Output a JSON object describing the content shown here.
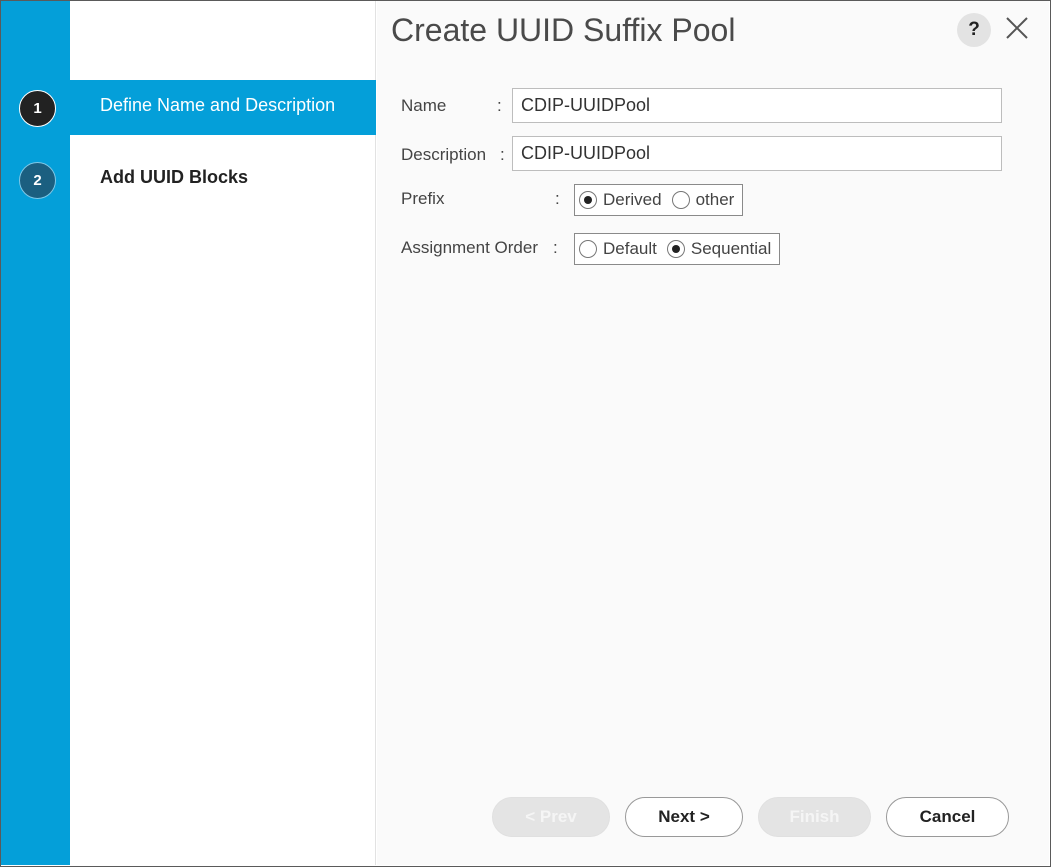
{
  "dialog": {
    "title": "Create UUID Suffix Pool",
    "help_icon": "question-mark-icon",
    "help_glyph": "?",
    "close_icon": "close-x-icon"
  },
  "wizard": {
    "steps": [
      {
        "number": "1",
        "label": "Define Name and Description",
        "active": true
      },
      {
        "number": "2",
        "label": "Add UUID Blocks",
        "active": false
      }
    ]
  },
  "form": {
    "name": {
      "label": "Name",
      "colon": ":",
      "value": "CDIP-UUIDPool"
    },
    "description": {
      "label": "Description",
      "colon": ":",
      "value": "CDIP-UUIDPool"
    },
    "prefix": {
      "label": "Prefix",
      "colon": ":",
      "options": [
        {
          "label": "Derived",
          "checked": true
        },
        {
          "label": "other",
          "checked": false
        }
      ]
    },
    "assignment_order": {
      "label": "Assignment Order",
      "colon": ":",
      "options": [
        {
          "label": "Default",
          "checked": false
        },
        {
          "label": "Sequential",
          "checked": true
        }
      ]
    }
  },
  "buttons": {
    "prev": "< Prev",
    "next": "Next >",
    "finish": "Finish",
    "cancel": "Cancel"
  },
  "colors": {
    "accent_blue": "#049fd9",
    "step_active_circle": "#222222",
    "step_inactive_circle": "#1b5f80"
  }
}
